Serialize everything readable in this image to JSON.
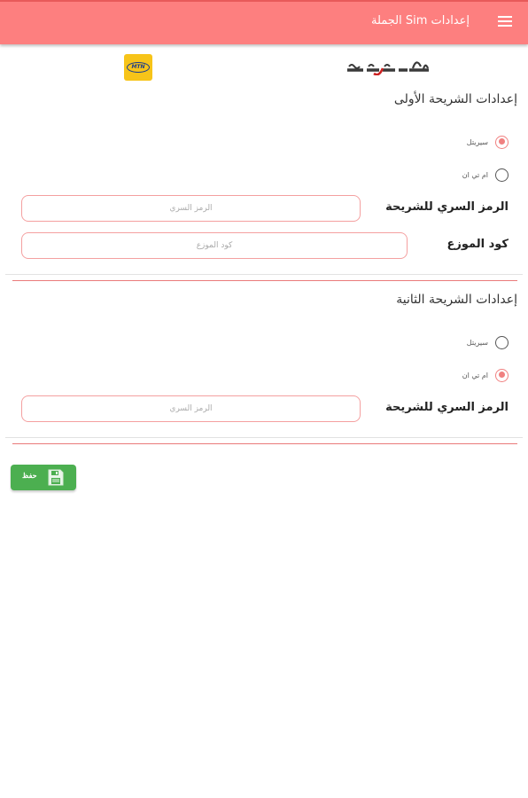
{
  "appbar": {
    "title": "إعدادات Sim الجملة",
    "menu_icon": "hamburger-menu-icon"
  },
  "logos": {
    "syriatel": "syriatel-logo",
    "mtn": {
      "icon": "mtn-logo",
      "text": "MTN"
    }
  },
  "first_sim": {
    "heading": "إعدادات الشريحة الأولى",
    "options": [
      {
        "label": "سيريتل",
        "checked": true
      },
      {
        "label": "ام تي ان",
        "checked": false
      }
    ],
    "pin_label": "الرمز السري للشريحة",
    "pin_placeholder": "الرمز السري",
    "distributor_label": "كود الموزع",
    "distributor_placeholder": "كود الموزع"
  },
  "second_sim": {
    "heading": "إعدادات الشريحة الثانية",
    "options": [
      {
        "label": "سيريتل",
        "checked": false
      },
      {
        "label": "ام تي ان",
        "checked": true
      }
    ],
    "pin_label": "الرمز السري للشريحة",
    "pin_placeholder": "الرمز السري"
  },
  "save_button": {
    "label": "حفظ",
    "icon": "floppy-disk-icon",
    "color": "#4caf50"
  },
  "colors": {
    "appbar": "#fd7f7f",
    "accent": "#f08080"
  }
}
